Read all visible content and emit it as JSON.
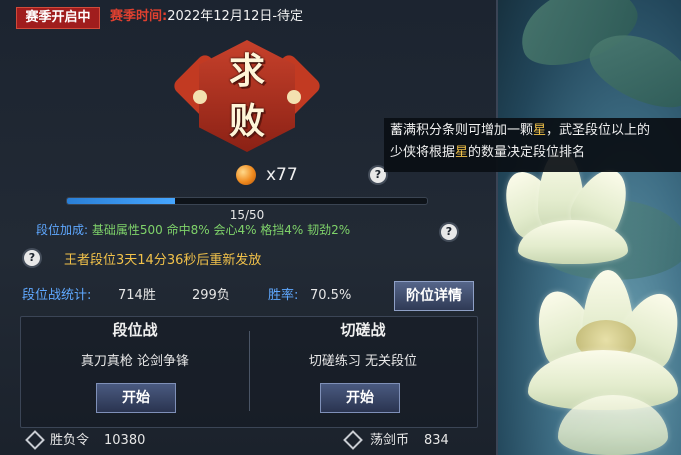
{
  "season": {
    "status_tag": "赛季开启中",
    "time_label": "赛季时间:",
    "time_value": "2022年12月12日-待定"
  },
  "emblem": {
    "char_top": "求",
    "char_bottom": "败"
  },
  "stars": {
    "count_text": "x77"
  },
  "progress": {
    "text": "15/50",
    "fraction": 0.3
  },
  "bonus": {
    "label": "段位加成:",
    "value": "基础属性500 命中8% 会心4% 格挡4% 韧劲2%"
  },
  "reset_notice": "王者段位3天14分36秒后重新发放",
  "stats": {
    "label": "段位战统计:",
    "wins": "714胜",
    "losses": "299负",
    "winrate_label": "胜率:",
    "winrate_value": "70.5%",
    "detail_button": "阶位详情"
  },
  "modes": [
    {
      "title": "段位战",
      "desc": "真刀真枪 论剑争锋",
      "button": "开始"
    },
    {
      "title": "切磋战",
      "desc": "切磋练习 无关段位",
      "button": "开始"
    }
  ],
  "currencies": [
    {
      "label": "胜负令",
      "value": "10380"
    },
    {
      "label": "荡剑币",
      "value": "834"
    }
  ],
  "tooltip": {
    "line1_a": "蓄满积分条则可增加一颗",
    "line1_star": "星",
    "line1_b": "，武圣段位以上的",
    "line2_a": "少侠将根据",
    "line2_star": "星",
    "line2_b": "的数量决定段位排名"
  },
  "help_glyph": "?",
  "colors": {
    "accent_blue": "#5fa8ff",
    "gold": "#f2c24a",
    "red_tag": "#a01d1d",
    "green_value": "#7fd36a"
  }
}
